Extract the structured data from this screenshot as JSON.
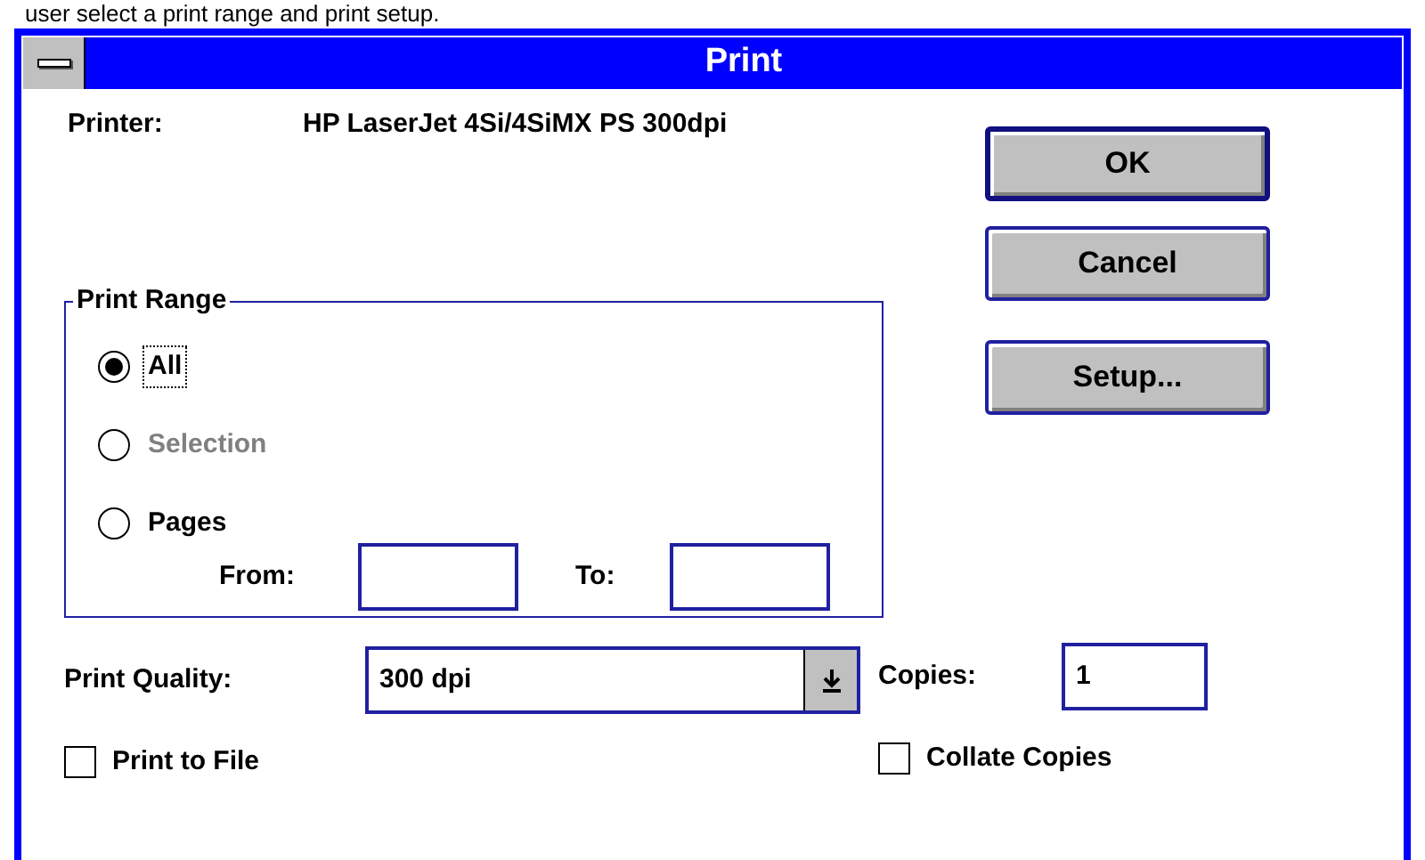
{
  "caption": "user select a print range and print setup.",
  "window": {
    "title": "Print"
  },
  "printer": {
    "label": "Printer:",
    "value": "HP LaserJet 4Si/4SiMX PS 300dpi"
  },
  "buttons": [
    {
      "label": "OK",
      "default": true
    },
    {
      "label": "Cancel",
      "default": false
    },
    {
      "label": "Setup...",
      "default": false
    }
  ],
  "print_range": {
    "title": "Print Range",
    "options": [
      {
        "label": "All",
        "selected": true,
        "disabled": false,
        "focused": true
      },
      {
        "label": "Selection",
        "selected": false,
        "disabled": true,
        "focused": false
      },
      {
        "label": "Pages",
        "selected": false,
        "disabled": false,
        "focused": false
      }
    ],
    "from": {
      "label": "From:"
    },
    "to": {
      "label": "To:"
    }
  },
  "print_quality": {
    "label": "Print Quality:",
    "value": "300 dpi"
  },
  "copies": {
    "label": "Copies:",
    "value": "1"
  },
  "checkboxes": [
    {
      "label": "Print to File",
      "checked": false
    },
    {
      "label": "Collate Copies",
      "checked": false
    }
  ]
}
